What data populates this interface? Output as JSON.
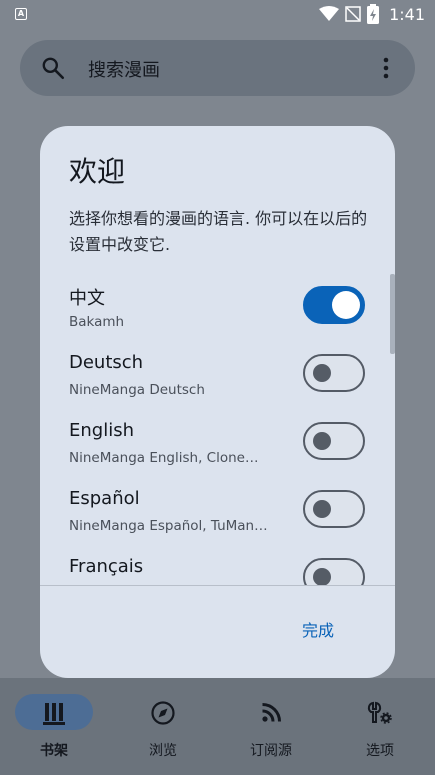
{
  "status_bar": {
    "time": "1:41",
    "icons": [
      "notification-a-icon",
      "wifi-icon",
      "no-signal-icon",
      "battery-charging-icon"
    ]
  },
  "search": {
    "placeholder": "搜索漫画",
    "icons": [
      "search-icon",
      "more-vert-icon"
    ]
  },
  "dialog": {
    "title": "欢迎",
    "description": "选择你想看的漫画的语言. 你可以在以后的设置中改变它.",
    "languages": [
      {
        "name": "中文",
        "sources": "Bakamh",
        "enabled": true
      },
      {
        "name": "Deutsch",
        "sources": "NineManga Deutsch",
        "enabled": false
      },
      {
        "name": "English",
        "sources": "NineManga English, Clone…",
        "enabled": false
      },
      {
        "name": "Español",
        "sources": "NineManga Español, TuMan…",
        "enabled": false
      },
      {
        "name": "Français",
        "sources": "",
        "enabled": false
      }
    ],
    "done_label": "完成"
  },
  "nav": {
    "items": [
      {
        "label": "书架",
        "icon": "bookshelf-icon",
        "active": true
      },
      {
        "label": "浏览",
        "icon": "compass-icon",
        "active": false
      },
      {
        "label": "订阅源",
        "icon": "rss-icon",
        "active": false
      },
      {
        "label": "选项",
        "icon": "settings-tools-icon",
        "active": false
      }
    ]
  },
  "colors": {
    "accent": "#0a63b8",
    "dialog_bg": "#dce3ee",
    "scrim": "#7f868f"
  }
}
